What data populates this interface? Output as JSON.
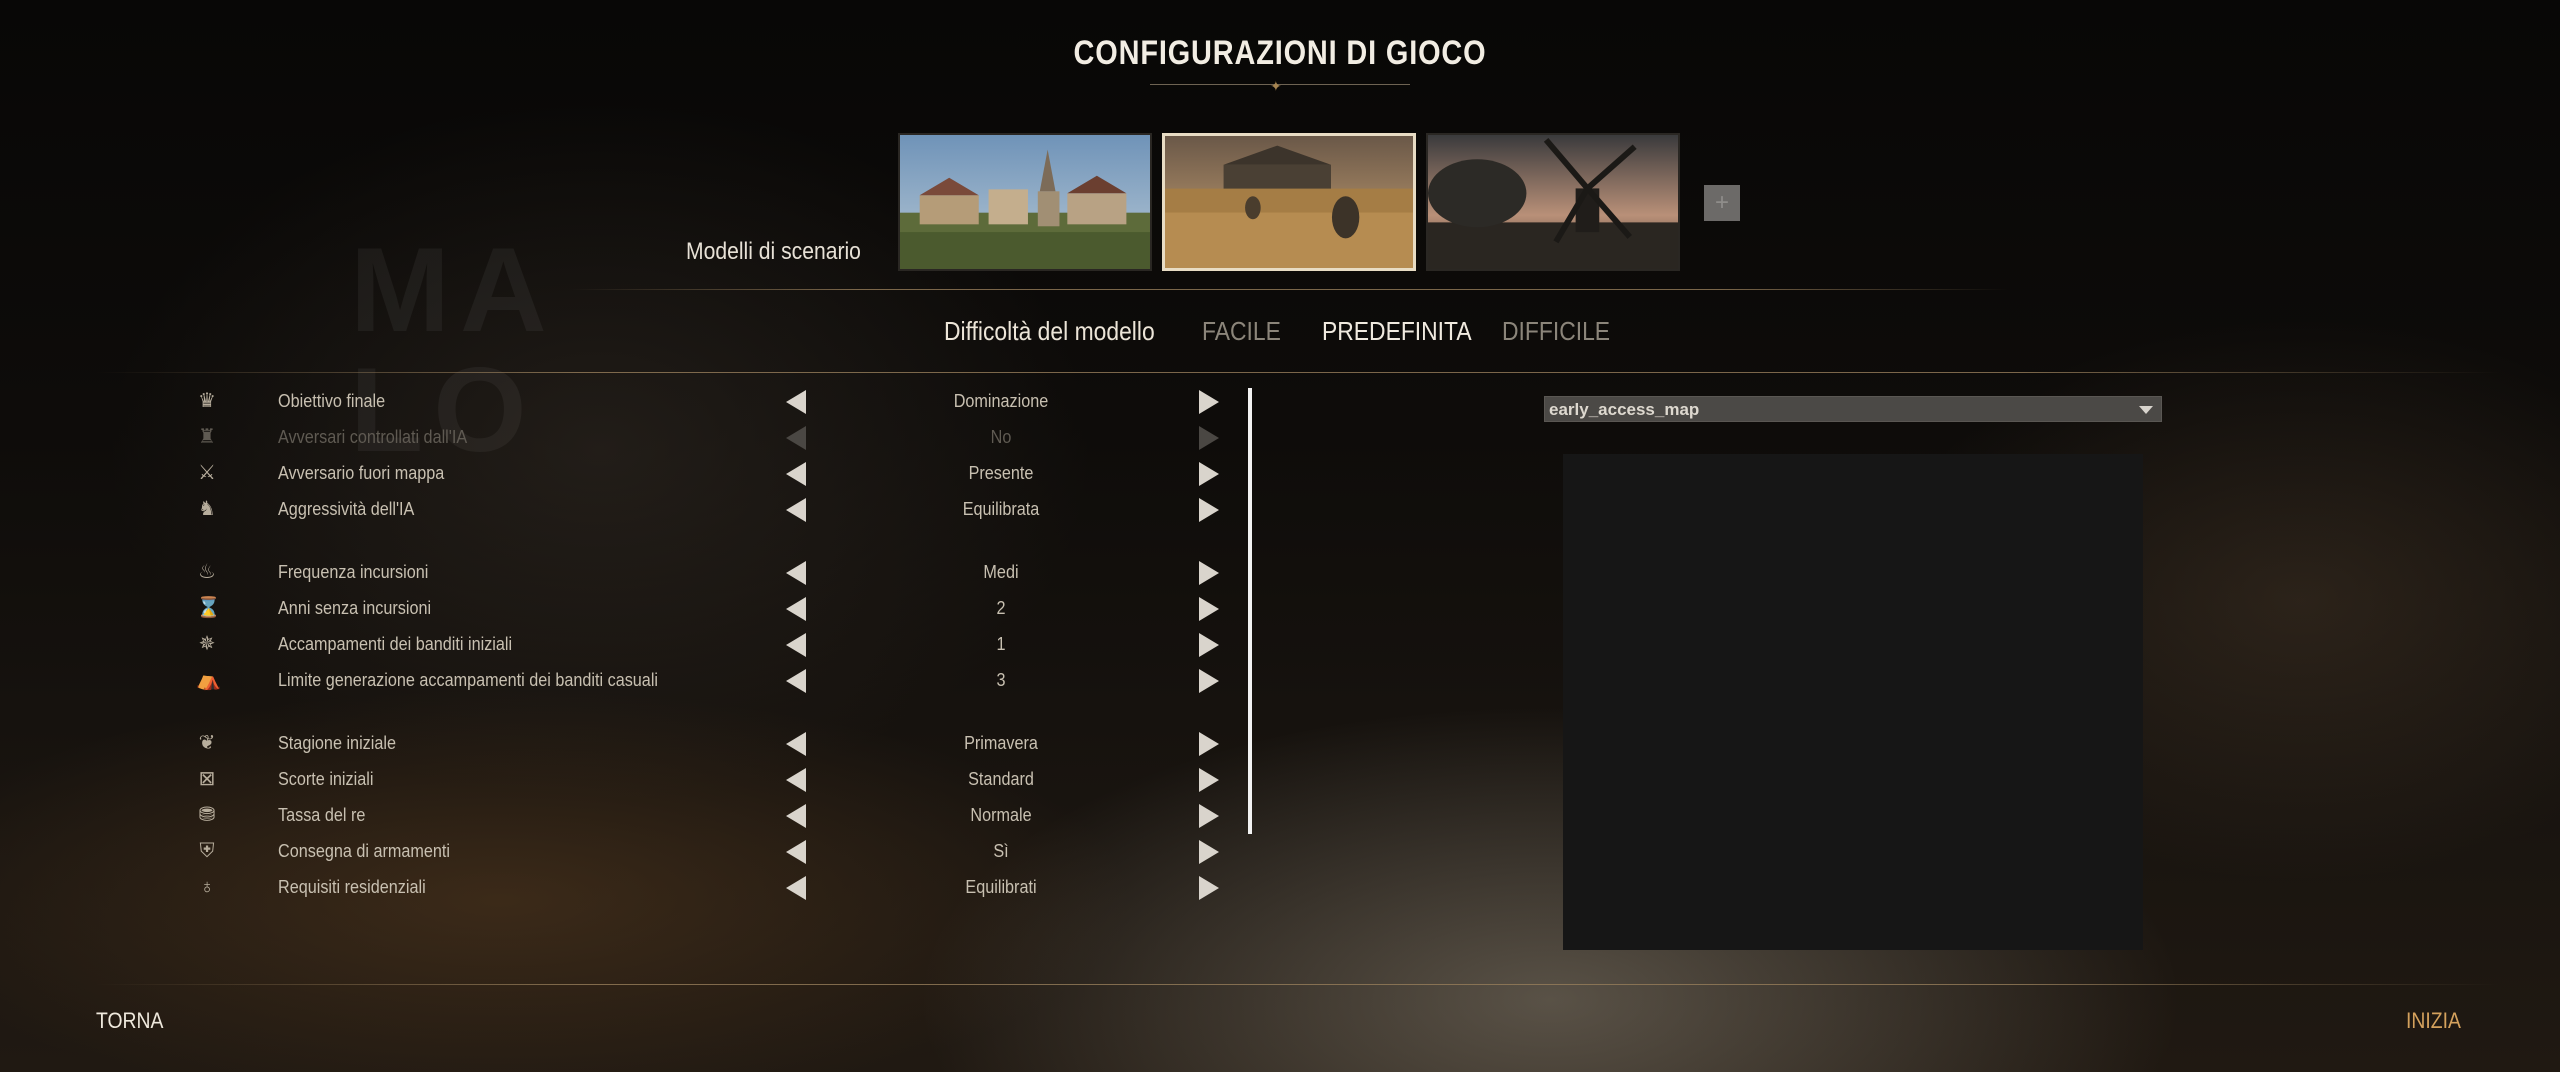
{
  "title": "CONFIGURAZIONI DI GIOCO",
  "scenario": {
    "label": "Modelli di scenario",
    "thumbnails": [
      {
        "name": "town-scene"
      },
      {
        "name": "wheat-field-scene",
        "selected": true
      },
      {
        "name": "windmill-scene"
      }
    ],
    "add_label": "+"
  },
  "difficulty": {
    "label": "Difficoltà del modello",
    "options": [
      {
        "label": "FACILE",
        "active": false
      },
      {
        "label": "PREDEFINITA",
        "active": true
      },
      {
        "label": "DIFFICILE",
        "active": false
      }
    ]
  },
  "settings": [
    {
      "icon": "crown-objective-icon",
      "glyph": "♛",
      "label": "Obiettivo finale",
      "value": "Dominazione"
    },
    {
      "icon": "crowns-icon",
      "glyph": "♜",
      "label": "Avversari controllati dall'IA",
      "value": "No",
      "disabled": true
    },
    {
      "icon": "crossed-swords-icon",
      "glyph": "⚔",
      "label": "Avversario fuori mappa",
      "value": "Presente"
    },
    {
      "icon": "knight-helmet-icon",
      "glyph": "♞",
      "label": "Aggressività dell'IA",
      "value": "Equilibrata"
    },
    {
      "icon": "flame-icon",
      "glyph": "♨",
      "label": "Frequenza incursioni",
      "value": "Medi"
    },
    {
      "icon": "hourglass-icon",
      "glyph": "⌛",
      "label": "Anni senza incursioni",
      "value": "2"
    },
    {
      "icon": "campfire-icon",
      "glyph": "✵",
      "label": "Accampamenti dei banditi iniziali",
      "value": "1"
    },
    {
      "icon": "tent-icon",
      "glyph": "⛺",
      "label": "Limite generazione accampamenti dei banditi casuali",
      "value": "3"
    },
    {
      "icon": "leaf-icon",
      "glyph": "❦",
      "label": "Stagione iniziale",
      "value": "Primavera"
    },
    {
      "icon": "crate-icon",
      "glyph": "⊠",
      "label": "Scorte iniziali",
      "value": "Standard"
    },
    {
      "icon": "coins-icon",
      "glyph": "⛃",
      "label": "Tassa del re",
      "value": "Normale"
    },
    {
      "icon": "shield-icon",
      "glyph": "⛨",
      "label": "Consegna di armamenti",
      "value": "Sì"
    },
    {
      "icon": "money-bag-icon",
      "glyph": "♁",
      "label": "Requisiti residenziali",
      "value": "Equilibrati"
    }
  ],
  "map": {
    "selected": "early_access_map"
  },
  "footer": {
    "back_label": "TORNA",
    "start_label": "INIZIA"
  },
  "colors": {
    "accent": "#d4a15d",
    "text": "#c8c0b1",
    "title": "#f2ede3"
  }
}
